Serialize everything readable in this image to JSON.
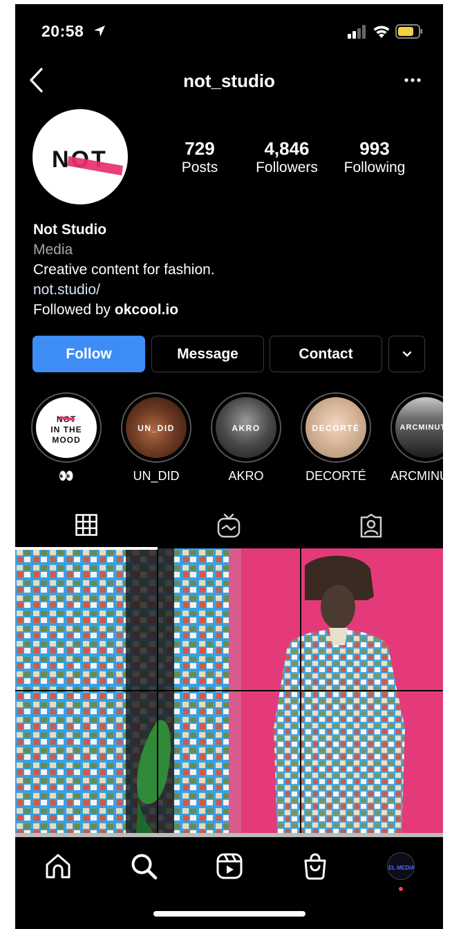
{
  "status_bar": {
    "time": "20:58"
  },
  "header": {
    "username": "not_studio"
  },
  "profile": {
    "avatar_text": "NOT",
    "stats": [
      {
        "value": "729",
        "label": "Posts"
      },
      {
        "value": "4,846",
        "label": "Followers"
      },
      {
        "value": "993",
        "label": "Following"
      }
    ],
    "name": "Not Studio",
    "category": "Media",
    "bio": "Creative content for fashion.",
    "link": "not.studio/",
    "followed_by_prefix": "Followed by ",
    "followed_by_user": "okcool.io"
  },
  "actions": {
    "follow": "Follow",
    "message": "Message",
    "contact": "Contact"
  },
  "highlights": [
    {
      "label": "👀",
      "cover": "NOT IN THE MOOD"
    },
    {
      "label": "UN_DID",
      "cover": "UN_DID"
    },
    {
      "label": "AKRO",
      "cover": "AKRO"
    },
    {
      "label": "DECORTÉ",
      "cover": "DECORTÉ"
    },
    {
      "label": "ARCMINUTE",
      "cover": "ARCMINUTE"
    }
  ],
  "tabs": [
    "grid-icon",
    "igtv-icon",
    "tagged-icon"
  ],
  "nav": [
    "home-icon",
    "search-icon",
    "reels-icon",
    "shop-icon",
    "profile-avatar"
  ],
  "nav_avatar_text": "EL MEDIA",
  "colors": {
    "follow_button": "#3d8df5",
    "background": "#000000",
    "accent_pink": "#e8306f",
    "notification_dot": "#ed4956"
  }
}
